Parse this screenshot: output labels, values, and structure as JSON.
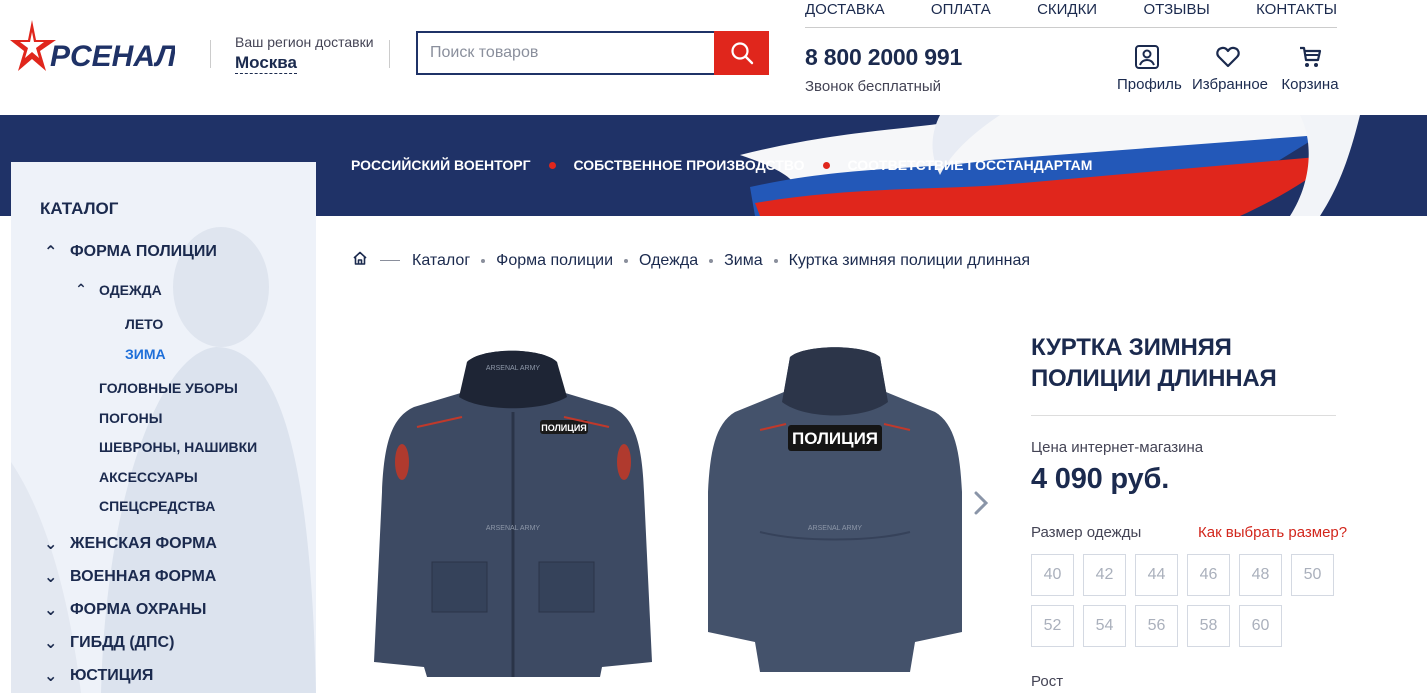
{
  "header": {
    "logo_text": "РСЕНАЛ",
    "region_label": "Ваш регион доставки",
    "region_city": "Москва",
    "search_placeholder": "Поиск товаров",
    "nav": [
      "ДОСТАВКА",
      "ОПЛАТА",
      "СКИДКИ",
      "ОТЗЫВЫ",
      "КОНТАКТЫ"
    ],
    "phone": "8 800 2000 991",
    "phone_note": "Звонок бесплатный",
    "profile_label": "Профиль",
    "favorites_label": "Избранное",
    "cart_label": "Корзина"
  },
  "banner": {
    "items": [
      "РОССИЙСКИЙ ВОЕНТОРГ",
      "СОБСТВЕННОЕ ПРОИЗВОДСТВО",
      "СООТВЕТСТВИЕ ГОССТАНДАРТАМ"
    ]
  },
  "sidebar": {
    "title": "КАТАЛОГ",
    "items": [
      {
        "label": "ФОРМА ПОЛИЦИИ",
        "chevron": "up"
      },
      {
        "label": "ОДЕЖДА",
        "chevron": "up"
      },
      {
        "label": "ЛЕТО"
      },
      {
        "label": "ЗИМА",
        "active": true
      },
      {
        "label": "ГОЛОВНЫЕ УБОРЫ"
      },
      {
        "label": "ПОГОНЫ"
      },
      {
        "label": "ШЕВРОНЫ, НАШИВКИ"
      },
      {
        "label": "АКСЕССУАРЫ"
      },
      {
        "label": "СПЕЦСРЕДСТВА"
      },
      {
        "label": "ЖЕНСКАЯ ФОРМА",
        "chevron": "down"
      },
      {
        "label": "ВОЕННАЯ ФОРМА",
        "chevron": "down"
      },
      {
        "label": "ФОРМА ОХРАНЫ",
        "chevron": "down"
      },
      {
        "label": "ГИБДД (ДПС)",
        "chevron": "down"
      },
      {
        "label": "ЮСТИЦИЯ",
        "chevron": "down"
      }
    ]
  },
  "breadcrumb": [
    "Каталог",
    "Форма полиции",
    "Одежда",
    "Зима",
    "Куртка зимняя полиции длинная"
  ],
  "product": {
    "title": "КУРТКА ЗИМНЯЯ ПОЛИЦИИ ДЛИННАЯ",
    "price_label": "Цена интернет-магазина",
    "price": "4 090 руб.",
    "size_label": "Размер одежды",
    "size_help": "Как выбрать размер?",
    "sizes": [
      "40",
      "42",
      "44",
      "46",
      "48",
      "50",
      "52",
      "54",
      "56",
      "58",
      "60"
    ],
    "height_label": "Рост",
    "front_patch": "ПОЛИЦИЯ",
    "back_patch": "ПОЛИЦИЯ",
    "watermark": "ARSENAL ARMY"
  },
  "colors": {
    "navy": "#1f3267",
    "red": "#e0261c",
    "active_blue": "#1e6fd9"
  }
}
